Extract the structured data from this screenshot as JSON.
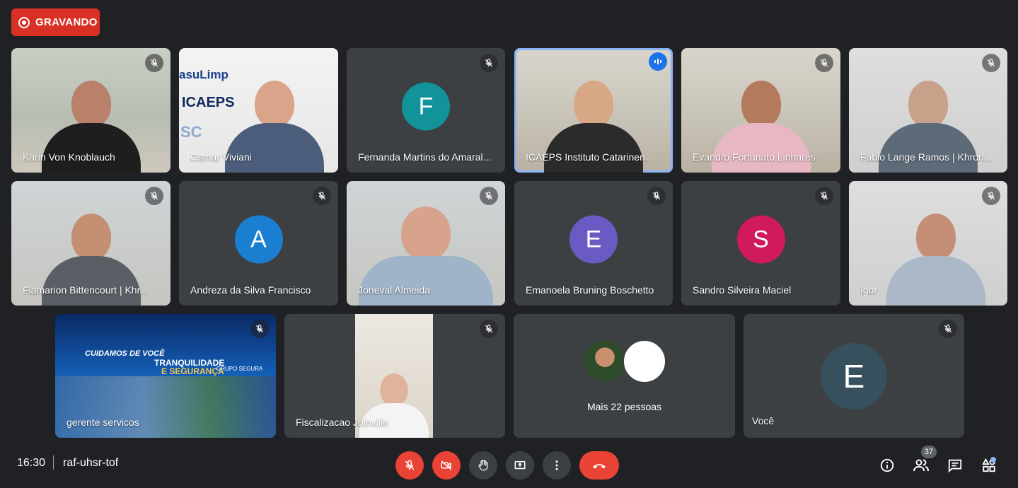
{
  "recording": {
    "label": "GRAVANDO",
    "color": "#d93025"
  },
  "participants": [
    {
      "name": "Karin Von Knoblauch",
      "muted": true,
      "video": true
    },
    {
      "name": "Osmar Viviani",
      "muted": false,
      "video": true,
      "background_text": [
        "asuLimp",
        "ICAEPS",
        "SC"
      ]
    },
    {
      "name": "Fernanda Martins do Amaral...",
      "muted": true,
      "video": false,
      "initial": "F",
      "avatar_color": "#12939a"
    },
    {
      "name": "ICAEPS Instituto Catarinen...",
      "muted": false,
      "video": true,
      "speaking": true
    },
    {
      "name": "Evandro Fortunato Linhares",
      "muted": true,
      "video": true
    },
    {
      "name": "Fabio Lange Ramos | Khron...",
      "muted": true,
      "video": true
    },
    {
      "name": "Flamarion Bittencourt | Khr...",
      "muted": true,
      "video": true
    },
    {
      "name": "Andreza da Silva Francisco",
      "muted": true,
      "video": false,
      "initial": "A",
      "avatar_color": "#1a7fd1"
    },
    {
      "name": "Joneval Almeida",
      "muted": true,
      "video": true
    },
    {
      "name": "Emanoela Bruning Boschetto",
      "muted": true,
      "video": false,
      "initial": "E",
      "avatar_color": "#6a5bc4"
    },
    {
      "name": "Sandro Silveira Maciel",
      "muted": true,
      "video": false,
      "initial": "S",
      "avatar_color": "#d01a5c"
    },
    {
      "name": "Igor",
      "muted": true,
      "video": true
    },
    {
      "name": "gerente servicos",
      "muted": true,
      "video": true,
      "banner": {
        "line1": "CUIDAMOS DE VOCÊ",
        "line2": "TRANQUILIDADE",
        "line3": "E SEGURANÇA",
        "brand": "GRUPO SEGURA"
      }
    },
    {
      "name": "Fiscalizacao Joinville",
      "muted": true,
      "video": true
    },
    {
      "name": "Você",
      "muted": true,
      "video": false,
      "initial": "E",
      "avatar_color": "#37505d"
    }
  ],
  "more_people": {
    "label": "Mais 22 pessoas"
  },
  "bottom_bar": {
    "time": "16:30",
    "meeting_code": "raf-uhsr-tof",
    "controls": [
      "mic-off",
      "camera-off",
      "raise-hand",
      "present",
      "more-options",
      "leave-call"
    ],
    "participant_count": "37"
  },
  "colors": {
    "background": "#202124",
    "tile": "#3c4043",
    "danger": "#ea4335",
    "accent": "#8ab4f8"
  }
}
